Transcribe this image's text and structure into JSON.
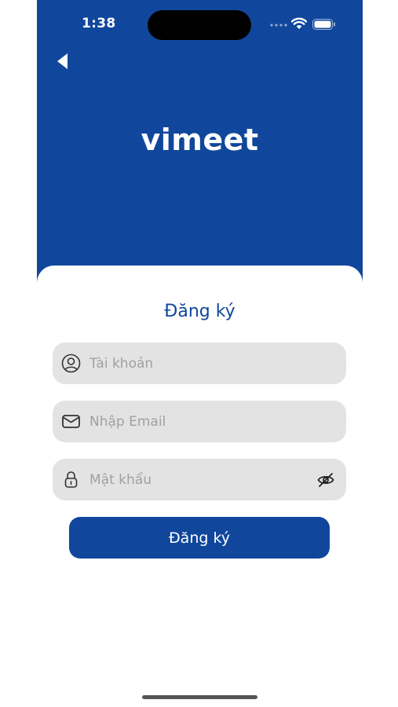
{
  "status_bar": {
    "time": "1:38",
    "signal_icon": "cellular-signal-icon",
    "wifi_icon": "wifi-icon",
    "battery_icon": "battery-icon"
  },
  "header": {
    "back_icon": "back-triangle-icon",
    "brand": "vimeet",
    "background_color": "#10479c"
  },
  "form": {
    "title": "Đăng ký",
    "fields": [
      {
        "icon": "user-circle-icon",
        "placeholder": "Tài khoản",
        "value": ""
      },
      {
        "icon": "envelope-icon",
        "placeholder": "Nhập Email",
        "value": ""
      },
      {
        "icon": "lock-icon",
        "placeholder": "Mật khẩu",
        "value": "",
        "toggle_icon": "eye-slash-icon"
      }
    ],
    "submit_label": "Đăng ký"
  },
  "colors": {
    "primary": "#10479c",
    "field_background": "#e3e3e3",
    "placeholder": "#a0a0a0"
  }
}
